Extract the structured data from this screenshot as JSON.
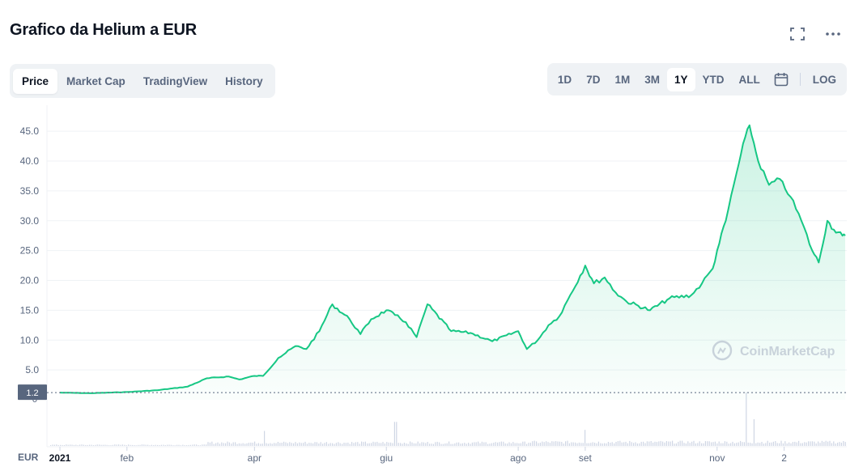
{
  "header": {
    "title": "Grafico da Helium a EUR",
    "icons": [
      "fullscreen-icon",
      "more-options-icon"
    ]
  },
  "tabs": [
    {
      "label": "Price",
      "active": true
    },
    {
      "label": "Market Cap",
      "active": false
    },
    {
      "label": "TradingView",
      "active": false
    },
    {
      "label": "History",
      "active": false
    }
  ],
  "ranges": [
    {
      "label": "1D",
      "active": false
    },
    {
      "label": "7D",
      "active": false
    },
    {
      "label": "1M",
      "active": false
    },
    {
      "label": "3M",
      "active": false
    },
    {
      "label": "1Y",
      "active": true
    },
    {
      "label": "YTD",
      "active": false
    },
    {
      "label": "ALL",
      "active": false
    }
  ],
  "log_label": "LOG",
  "currency_label": "EUR",
  "watermark": "CoinMarketCap",
  "colors": {
    "line": "#16c784",
    "accent_text": "#0d1421",
    "muted": "#58667e",
    "grid": "#eff2f5"
  },
  "chart_data": {
    "type": "area",
    "ylim": [
      0,
      48
    ],
    "yticks": [
      5,
      10,
      15,
      20,
      25,
      30,
      35,
      40,
      45
    ],
    "ytick_labels": [
      "5.0",
      "10.0",
      "15.0",
      "20.0",
      "25.0",
      "30.0",
      "35.0",
      "40.0",
      "45.0"
    ],
    "current_price_label": "1.2",
    "current_price": 1.2,
    "x_dates": [
      "2021-01-01",
      "2021-01-15",
      "2021-02-01",
      "2021-02-15",
      "2021-03-01",
      "2021-03-10",
      "2021-03-20",
      "2021-03-25",
      "2021-04-01",
      "2021-04-05",
      "2021-04-12",
      "2021-04-20",
      "2021-04-25",
      "2021-05-01",
      "2021-05-07",
      "2021-05-15",
      "2021-05-20",
      "2021-05-25",
      "2021-06-01",
      "2021-06-05",
      "2021-06-10",
      "2021-06-15",
      "2021-06-20",
      "2021-07-01",
      "2021-07-10",
      "2021-07-20",
      "2021-08-01",
      "2021-08-05",
      "2021-08-10",
      "2021-08-15",
      "2021-08-20",
      "2021-08-25",
      "2021-09-01",
      "2021-09-05",
      "2021-09-10",
      "2021-09-15",
      "2021-09-20",
      "2021-10-01",
      "2021-10-10",
      "2021-10-20",
      "2021-10-25",
      "2021-10-30",
      "2021-11-01",
      "2021-11-05",
      "2021-11-10",
      "2021-11-14",
      "2021-11-16",
      "2021-11-20",
      "2021-11-25",
      "2021-11-30",
      "2021-12-05",
      "2021-12-10",
      "2021-12-15",
      "2021-12-18",
      "2021-12-22",
      "2021-12-25",
      "2021-12-29"
    ],
    "y_values": [
      1.2,
      1.1,
      1.3,
      1.6,
      2.2,
      3.6,
      3.9,
      3.4,
      4.0,
      4.0,
      7.0,
      9.0,
      8.5,
      11.5,
      16.0,
      13.5,
      11.0,
      13.5,
      15.0,
      14.2,
      13.0,
      10.5,
      16.0,
      11.5,
      11.2,
      9.8,
      11.5,
      8.5,
      10.0,
      12.5,
      14.0,
      17.5,
      22.5,
      19.5,
      20.5,
      18.0,
      16.5,
      15.0,
      17.0,
      17.5,
      19.5,
      22.0,
      25.0,
      30.0,
      38.0,
      44.0,
      46.0,
      40.0,
      36.0,
      37.0,
      34.0,
      30.0,
      25.0,
      23.0,
      30.0,
      28.5,
      27.5
    ],
    "x_tick_labels": [
      {
        "label": "2021",
        "date": "2021-01-01",
        "bold": true
      },
      {
        "label": "feb",
        "date": "2021-02-01"
      },
      {
        "label": "apr",
        "date": "2021-04-01"
      },
      {
        "label": "giu",
        "date": "2021-06-01"
      },
      {
        "label": "ago",
        "date": "2021-08-01"
      },
      {
        "label": "set",
        "date": "2021-09-01"
      },
      {
        "label": "nov",
        "date": "2021-11-01"
      },
      {
        "label": "2",
        "date": "2021-12-02"
      }
    ],
    "volume_axis_label": "0",
    "volume_spikes": [
      {
        "date": "2021-04-05",
        "value": 0.28
      },
      {
        "date": "2021-06-05",
        "value": 0.45
      },
      {
        "date": "2021-09-01",
        "value": 0.3
      },
      {
        "date": "2021-11-14",
        "value": 1.0
      },
      {
        "date": "2021-11-18",
        "value": 0.5
      }
    ]
  }
}
